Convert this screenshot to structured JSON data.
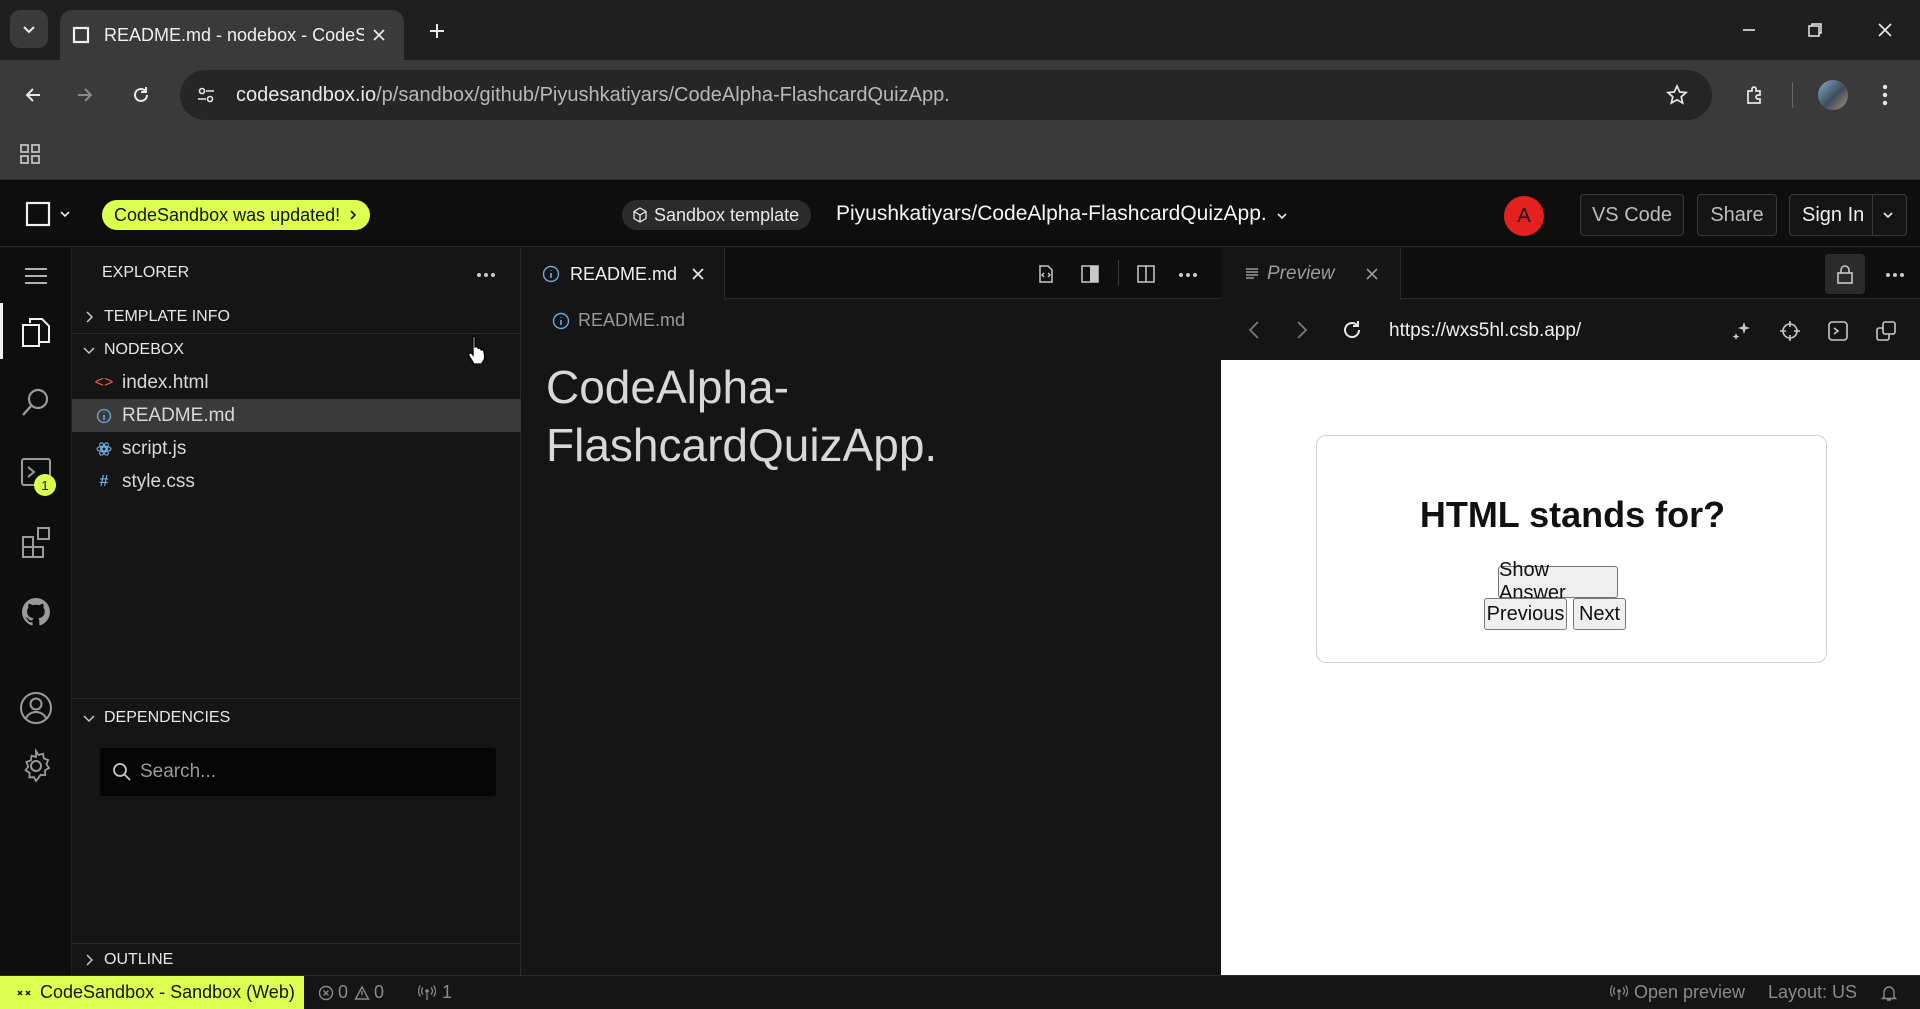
{
  "browser": {
    "tab_title": "README.md - nodebox - CodeSandbox",
    "url_host": "codesandbox.io",
    "url_path": "/p/sandbox/github/Piyushkatiyars/CodeAlpha-FlashcardQuizApp."
  },
  "header": {
    "update_pill": "CodeSandbox was updated!",
    "template_badge": "Sandbox template",
    "project_name": "Piyushkatiyars/CodeAlpha-FlashcardQuizApp.",
    "avatar_letter": "A",
    "vscode_btn": "VS Code",
    "share_btn": "Share",
    "signin_btn": "Sign In"
  },
  "activity": {
    "terminal_badge": "1"
  },
  "sidebar": {
    "title": "EXPLORER",
    "template_info": "TEMPLATE INFO",
    "nodebox": "NODEBOX",
    "files": [
      {
        "name": "index.html",
        "icon": "<>"
      },
      {
        "name": "README.md",
        "icon": "i"
      },
      {
        "name": "script.js",
        "icon": "js"
      },
      {
        "name": "style.css",
        "icon": "#"
      }
    ],
    "dependencies": "DEPENDENCIES",
    "search_placeholder": "Search...",
    "outline": "OUTLINE"
  },
  "editor": {
    "tab_label": "README.md",
    "breadcrumb": "README.md",
    "heading_line1": "CodeAlpha-",
    "heading_line2": "FlashcardQuizApp."
  },
  "preview": {
    "tab_label": "Preview",
    "url": "https://wxs5hl.csb.app/",
    "question": "HTML stands for?",
    "show_answer": "Show Answer",
    "previous": "Previous",
    "next": "Next"
  },
  "status": {
    "env": "CodeSandbox - Sandbox (Web)",
    "errors": "0",
    "warnings": "0",
    "ports": "1",
    "open_preview": "Open preview",
    "layout": "Layout: US"
  },
  "colors": {
    "accent": "#dcff50",
    "avatar": "#e5211f"
  }
}
